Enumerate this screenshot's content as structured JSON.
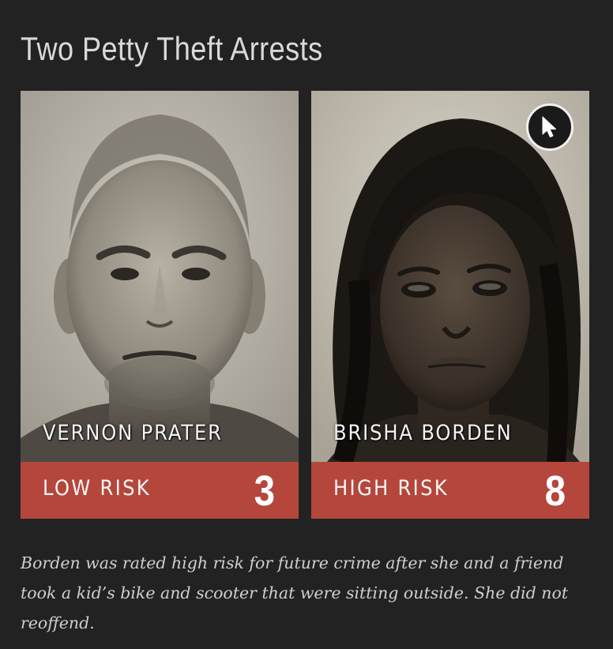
{
  "title": "Two Petty Theft Arrests",
  "people": [
    {
      "name": "VERNON PRATER",
      "risk_label": "LOW RISK",
      "risk_score": "3"
    },
    {
      "name": "BRISHA BORDEN",
      "risk_label": "HIGH RISK",
      "risk_score": "8"
    }
  ],
  "caption": "Borden was rated high risk for future crime after she and a friend took a kid’s bike and scooter that were sitting outside. She did not reoffend.",
  "colors": {
    "background": "#222222",
    "risk_bar": "#b5463c",
    "text": "#d9d9d9"
  },
  "icons": {
    "cursor": "cursor-arrow-icon"
  }
}
